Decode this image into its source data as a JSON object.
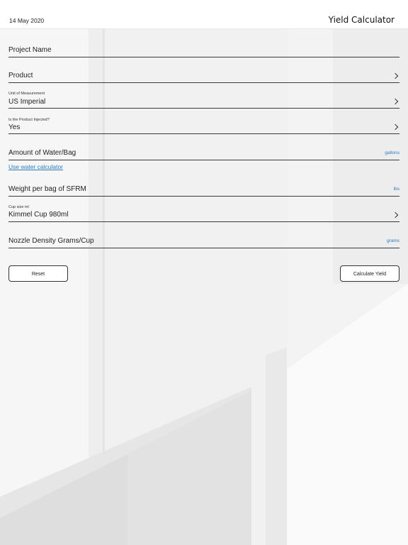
{
  "header": {
    "date": "14 May 2020",
    "title": "Yield Calculator"
  },
  "form": {
    "project_name": {
      "label": "Project Name"
    },
    "product": {
      "label": "Product"
    },
    "unit_of_measurement": {
      "small_label": "Unit of Measurement",
      "value": "US Imperial"
    },
    "product_injected": {
      "small_label": "Is the Product Injected?",
      "value": "Yes"
    },
    "amount_water": {
      "label": "Amount of Water/Bag",
      "unit": "gallons"
    },
    "water_calculator_link": "Use water calculator",
    "weight_per_bag": {
      "label": "Weight per bag of SFRM",
      "unit": "lbs"
    },
    "cup_size": {
      "small_label": "Cup size ml",
      "value": "Kimmel Cup 980ml"
    },
    "nozzle_density": {
      "label": "Nozzle Density Grams/Cup",
      "unit": "grams"
    }
  },
  "buttons": {
    "reset": "Reset",
    "calculate": "Calculate Yield"
  },
  "colors": {
    "accent": "#2a7bbd",
    "line": "#3a3a3a",
    "background": "#f2f2f2"
  },
  "icons": [
    "chevron-right-icon"
  ]
}
